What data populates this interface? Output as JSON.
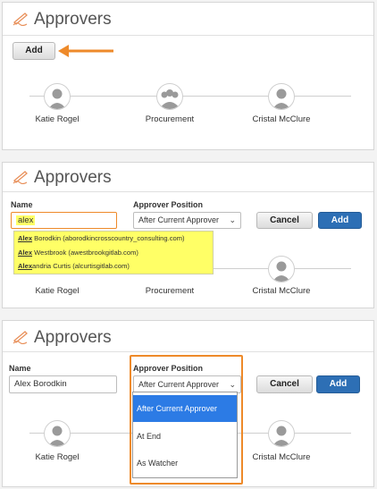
{
  "panel1": {
    "title": "Approvers",
    "add_label": "Add",
    "approvers": [
      "Katie Rogel",
      "Procurement",
      "Cristal McClure"
    ]
  },
  "panel2": {
    "title": "Approvers",
    "name_label": "Name",
    "name_value": "alex",
    "position_label": "Approver Position",
    "position_value": "After Current Approver",
    "cancel_label": "Cancel",
    "add_label": "Add",
    "suggestions": [
      {
        "match": "Alex",
        "rest": " Borodkin (aborodkincrosscountry_consulting.com)"
      },
      {
        "match": "Alex",
        "rest": " Westbrook (awestbrookgitlab.com)"
      },
      {
        "match": "Alex",
        "rest": "andria Curtis (alcurtisgitlab.com)"
      }
    ],
    "approvers": [
      "Katie Rogel",
      "Procurement",
      "Cristal McClure"
    ]
  },
  "panel3": {
    "title": "Approvers",
    "name_label": "Name",
    "name_value": "Alex Borodkin",
    "position_label": "Approver Position",
    "position_value": "After Current Approver",
    "cancel_label": "Cancel",
    "add_label": "Add",
    "options": [
      "After Current Approver",
      "At End",
      "As Watcher"
    ],
    "approvers": [
      "Katie Rogel",
      "Cristal McClure"
    ]
  },
  "colors": {
    "accent_orange": "#ee8a2a",
    "button_blue": "#2d6fb5",
    "highlight_yellow": "#ffff66",
    "selected_option": "#2c7be5"
  }
}
